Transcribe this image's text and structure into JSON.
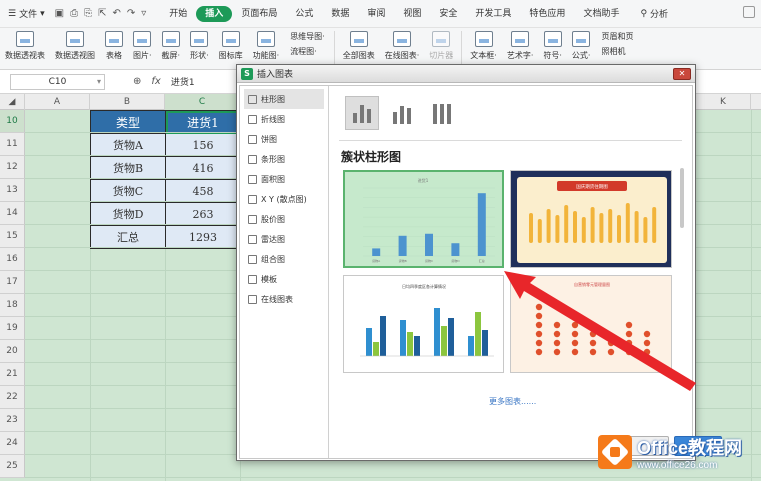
{
  "menubar": {
    "file_label": "文件",
    "tabs": [
      "开始",
      "插入",
      "页面布局",
      "公式",
      "数据",
      "审阅",
      "视图",
      "安全",
      "开发工具",
      "特色应用",
      "文档助手"
    ],
    "active_tab": "插入",
    "search_label": "分析"
  },
  "ribbon": {
    "buttons": [
      {
        "label": "数据透视表",
        "icon": "pivot-table-icon"
      },
      {
        "label": "数据透视图",
        "icon": "pivot-chart-icon"
      },
      {
        "label": "表格",
        "icon": "table-icon"
      },
      {
        "label": "图片·",
        "icon": "picture-icon"
      },
      {
        "label": "截屏·",
        "icon": "screenshot-icon"
      },
      {
        "label": "形状·",
        "icon": "shape-icon"
      },
      {
        "label": "图标库",
        "icon": "icon-library-icon"
      },
      {
        "label": "功能图·",
        "icon": "function-chart-icon"
      }
    ],
    "small_col": [
      "思维导图·",
      "流程图·"
    ],
    "buttons2": [
      {
        "label": "全部图表",
        "icon": "all-charts-icon"
      },
      {
        "label": "在线图表·",
        "icon": "online-chart-icon"
      }
    ],
    "slicer_label": "切片器",
    "buttons3": [
      {
        "label": "文本框·",
        "icon": "textbox-icon"
      },
      {
        "label": "艺术字·",
        "icon": "wordart-icon"
      },
      {
        "label": "符号·",
        "icon": "symbol-icon"
      },
      {
        "label": "公式·",
        "icon": "formula-icon"
      }
    ],
    "right_col": [
      "页眉和页",
      "照相机"
    ]
  },
  "formula_bar": {
    "name_box": "C10",
    "value": "进货1"
  },
  "grid": {
    "columns": [
      "A",
      "B",
      "C",
      "K"
    ],
    "rows": [
      "10",
      "11",
      "12",
      "13",
      "14",
      "15",
      "16",
      "17",
      "18",
      "19",
      "20",
      "21",
      "22",
      "23",
      "24",
      "25"
    ]
  },
  "table": {
    "header": [
      "类型",
      "进货1"
    ],
    "rows": [
      [
        "货物A",
        "156"
      ],
      [
        "货物B",
        "416"
      ],
      [
        "货物C",
        "458"
      ],
      [
        "货物D",
        "263"
      ],
      [
        "汇总",
        "1293"
      ]
    ]
  },
  "dialog": {
    "title": "插入图表",
    "close_icon": "close-icon",
    "sidebar": [
      {
        "label": "柱形图",
        "icon": "column-chart-icon"
      },
      {
        "label": "折线图",
        "icon": "line-chart-icon"
      },
      {
        "label": "饼图",
        "icon": "pie-chart-icon"
      },
      {
        "label": "条形图",
        "icon": "bar-chart-icon"
      },
      {
        "label": "面积图",
        "icon": "area-chart-icon"
      },
      {
        "label": "X Y (散点图)",
        "icon": "scatter-chart-icon"
      },
      {
        "label": "股价图",
        "icon": "stock-chart-icon"
      },
      {
        "label": "雷达图",
        "icon": "radar-chart-icon"
      },
      {
        "label": "组合图",
        "icon": "combo-chart-icon"
      },
      {
        "label": "模板",
        "icon": "template-icon"
      },
      {
        "label": "在线图表",
        "icon": "online-chart-icon"
      }
    ],
    "active_item": "柱形图",
    "section_title": "簇状柱形图",
    "thumb1": {
      "title": "进货1",
      "categories": [
        "货物A",
        "货物B",
        "货物C",
        "货物D",
        "汇总"
      ],
      "values": [
        156,
        416,
        458,
        263,
        1293
      ]
    },
    "thumb2": {
      "title": "国庆期货往期图"
    },
    "thumb3": {
      "title": "日均四季度区各计算情况"
    },
    "thumb4": {
      "title": "自营销零元管理量图"
    },
    "more_label": "更多图表......",
    "ok_label": "",
    "cancel_label": ""
  },
  "watermark": {
    "line1": "Office教程网",
    "line2": "www.office26.com"
  },
  "colors": {
    "accent": "#1d9a58",
    "table_header": "#2f6ea8",
    "table_cell": "#dfe9f5",
    "arrow": "#e8262a",
    "sheet_bg": "#cfe6d2"
  }
}
